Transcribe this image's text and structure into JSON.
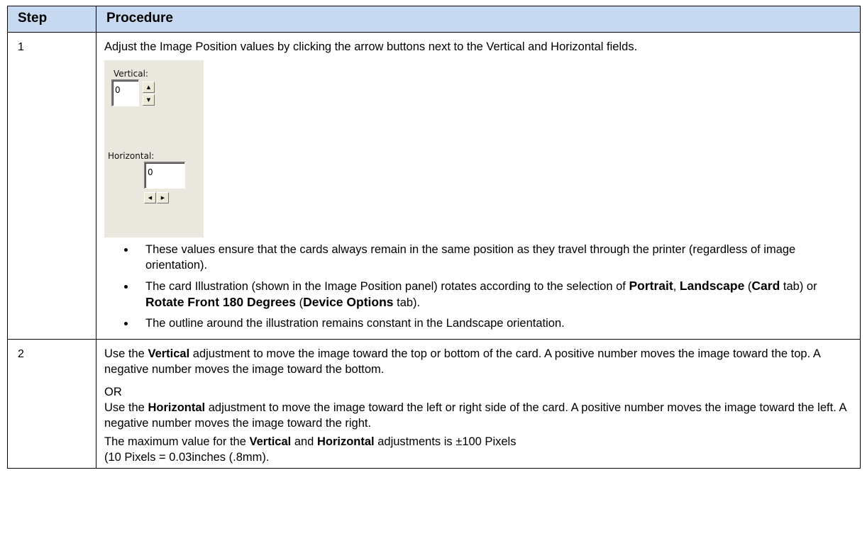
{
  "header": {
    "step": "Step",
    "procedure": "Procedure"
  },
  "step1": {
    "num": "1",
    "intro": "Adjust the Image Position values by clicking the arrow buttons next to the Vertical and Horizontal fields.",
    "panel": {
      "vertical_label": "Vertical:",
      "vertical_value": "0",
      "horizontal_label": "Horizontal:",
      "horizontal_value": "0"
    },
    "bullets": {
      "b1": "These values ensure that the cards always remain in the same position as they travel through the printer (regardless of image orientation).",
      "b2_a": "The card Illustration (shown in the Image Position panel) rotates according to the selection of",
      "b2_portrait": "Portrait",
      "b2_comma": ",",
      "b2_landscape": "Landscape",
      "b2_paren1": "(",
      "b2_card": "Card",
      "b2_tab1": "tab) or",
      "b2_rotate": "Rotate Front 180 Degrees",
      "b2_paren2": "(",
      "b2_device": "Device Options",
      "b2_tab2": "tab).",
      "b3": "The outline around the illustration remains constant in the Landscape orientation."
    }
  },
  "step2": {
    "num": "2",
    "p1_a": "Use the",
    "p1_bold": "Vertical",
    "p1_b": "adjustment to move the image toward the top or bottom of the card. A positive number moves the image toward the top. A negative number moves the image toward the bottom.",
    "or": "OR",
    "p2_a": "Use the",
    "p2_bold": "Horizontal",
    "p2_b": "adjustment to move the image toward the left or right side of the card. A positive number moves the image toward the left. A negative number moves the image toward the right.",
    "p3_a": "The maximum value for the",
    "p3_bold1": "Vertical",
    "p3_and": "and",
    "p3_bold2": "Horizontal",
    "p3_b": "adjustments is ±100 Pixels",
    "p3_c": "(10 Pixels = 0.03inches (.8mm)."
  }
}
